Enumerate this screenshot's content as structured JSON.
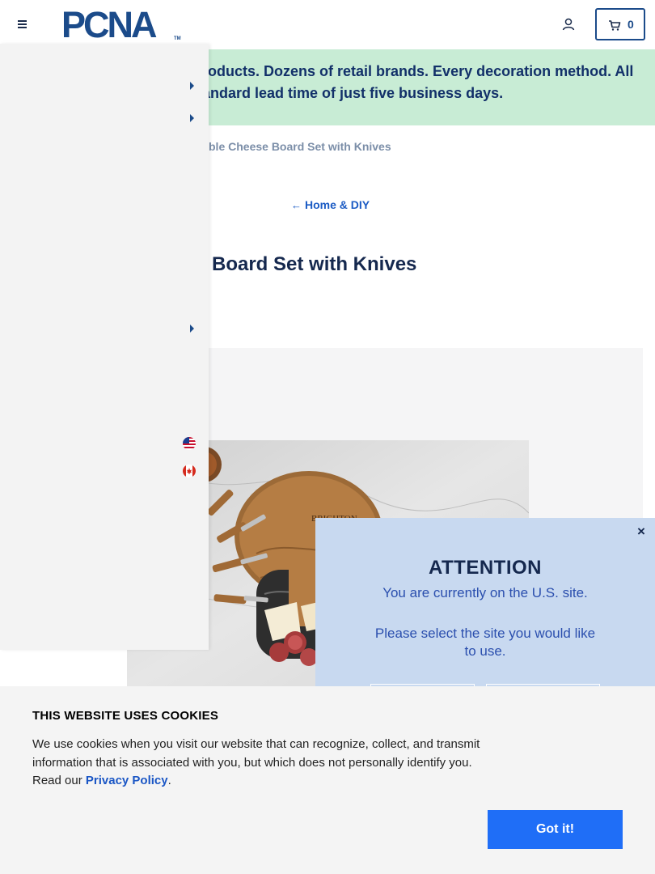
{
  "header": {
    "logo_text": "PCNA",
    "logo_mark": "TM",
    "cart_count": "0",
    "brand_color": "#1b4b8a"
  },
  "promo": {
    "text_visible": "roducts. Dozens of retail brands. Every decoration method. All",
    "text_line2": "andard lead time of just five business days.",
    "background": "#c8ecd5"
  },
  "breadcrumb": {
    "current": "ble Cheese Board Set with Knives"
  },
  "back_link": {
    "label": "Home & DIY"
  },
  "product": {
    "title_visible": "Board Set with Knives",
    "image_logo_text": "BRIGHTON"
  },
  "drawer": {
    "flags": [
      "us-flag-icon",
      "canada-flag-icon"
    ]
  },
  "attention_modal": {
    "title": "ATTENTION",
    "line1": "You are currently on the U.S. site.",
    "line2": "Please select the site you would like to use.",
    "close": "×"
  },
  "cookie_banner": {
    "title": "THIS WEBSITE USES COOKIES",
    "body_pre": "We use cookies when you visit our website that can recognize, collect, and transmit information that is associated with you, but which does not personally identify you. Read our ",
    "link": "Privacy Policy",
    "body_post": ".",
    "button": "Got it!",
    "button_color": "#1f6ef7"
  }
}
